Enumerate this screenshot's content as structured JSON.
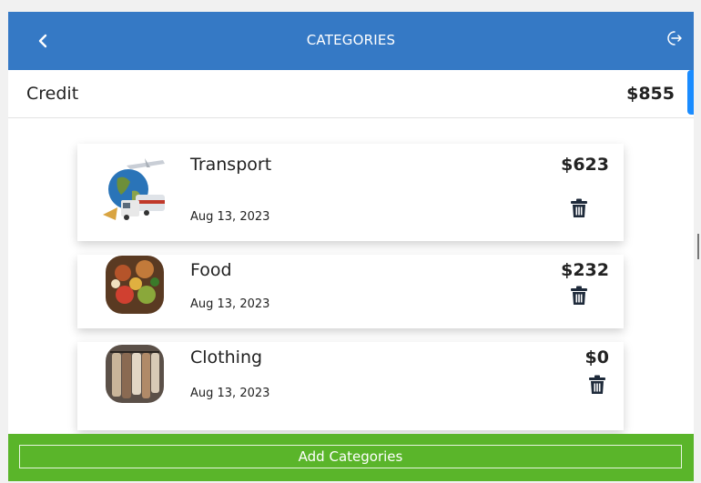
{
  "header": {
    "title": "CATEGORIES",
    "back_icon": "chevron-left-icon",
    "logout_icon": "logout-icon"
  },
  "credit": {
    "label": "Credit",
    "value": "$855"
  },
  "categories": [
    {
      "name": "Transport",
      "amount": "$623",
      "date": "Aug 13, 2023",
      "image": "transport-image"
    },
    {
      "name": "Food",
      "amount": "$232",
      "date": "Aug 13, 2023",
      "image": "food-image"
    },
    {
      "name": "Clothing",
      "amount": "$0",
      "date": "Aug 13, 2023",
      "image": "clothing-image"
    }
  ],
  "footer": {
    "add_label": "Add Categories"
  },
  "colors": {
    "header": "#3579c5",
    "footer": "#5ab52a",
    "accent": "#1a8cff"
  }
}
